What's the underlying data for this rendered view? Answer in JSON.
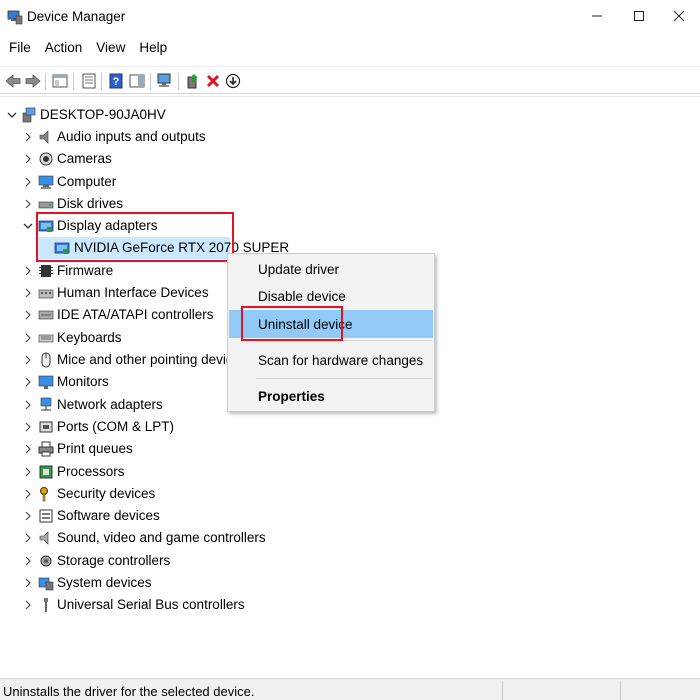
{
  "window": {
    "title": "Device Manager",
    "minimize_glyph": "—",
    "maximize_glyph": "☐",
    "close_glyph": "✕"
  },
  "menu": [
    "File",
    "Action",
    "View",
    "Help"
  ],
  "toolbar": {
    "icons": [
      "back-arrow-icon",
      "forward-arrow-icon",
      "console-tree-icon",
      "properties-icon",
      "help-icon",
      "action-pane-icon",
      "scan-hardware-icon",
      "update-driver-icon",
      "uninstall-device-icon",
      "disable-device-icon"
    ],
    "uninstall_color": "#e81123",
    "update_color": "#1e9e3a"
  },
  "tree": {
    "root": "DESKTOP-90JA0HV",
    "categories": [
      {
        "label": "Audio inputs and outputs",
        "icon": "speaker-icon",
        "expanded": false
      },
      {
        "label": "Cameras",
        "icon": "camera-icon",
        "expanded": false
      },
      {
        "label": "Computer",
        "icon": "computer-icon",
        "expanded": false
      },
      {
        "label": "Disk drives",
        "icon": "disk-drive-icon",
        "expanded": false
      },
      {
        "label": "Display adapters",
        "icon": "display-adapter-icon",
        "expanded": true,
        "children": [
          "NVIDIA GeForce RTX 2070 SUPER"
        ]
      },
      {
        "label": "Firmware",
        "icon": "firmware-icon",
        "expanded": false
      },
      {
        "label": "Human Interface Devices",
        "icon": "hid-icon",
        "expanded": false
      },
      {
        "label": "IDE ATA/ATAPI controllers",
        "icon": "ide-controller-icon",
        "expanded": false
      },
      {
        "label": "Keyboards",
        "icon": "keyboard-icon",
        "expanded": false
      },
      {
        "label": "Mice and other pointing devices",
        "icon": "mouse-icon",
        "expanded": false
      },
      {
        "label": "Monitors",
        "icon": "monitor-icon",
        "expanded": false
      },
      {
        "label": "Network adapters",
        "icon": "network-adapter-icon",
        "expanded": false
      },
      {
        "label": "Ports (COM & LPT)",
        "icon": "port-icon",
        "expanded": false
      },
      {
        "label": "Print queues",
        "icon": "printer-icon",
        "expanded": false
      },
      {
        "label": "Processors",
        "icon": "processor-icon",
        "expanded": false
      },
      {
        "label": "Security devices",
        "icon": "security-key-icon",
        "expanded": false
      },
      {
        "label": "Software devices",
        "icon": "software-device-icon",
        "expanded": false
      },
      {
        "label": "Sound, video and game controllers",
        "icon": "sound-icon",
        "expanded": false
      },
      {
        "label": "Storage controllers",
        "icon": "storage-controller-icon",
        "expanded": false
      },
      {
        "label": "System devices",
        "icon": "system-devices-icon",
        "expanded": false
      },
      {
        "label": "Universal Serial Bus controllers",
        "icon": "usb-icon",
        "expanded": false
      }
    ],
    "selected_device": "NVIDIA GeForce RTX 2070 SUPER",
    "selection_color": "#cce8ff",
    "highlight_color": "#e81123"
  },
  "context_menu": {
    "items": [
      {
        "label": "Update driver"
      },
      {
        "label": "Disable device"
      },
      {
        "label": "Uninstall device",
        "hover": true
      },
      {
        "label": "Scan for hardware changes"
      },
      {
        "label": "Properties",
        "bold": true
      }
    ],
    "hover_color": "#91c9f7"
  },
  "status_bar": {
    "text": "Uninstalls the driver for the selected device."
  }
}
